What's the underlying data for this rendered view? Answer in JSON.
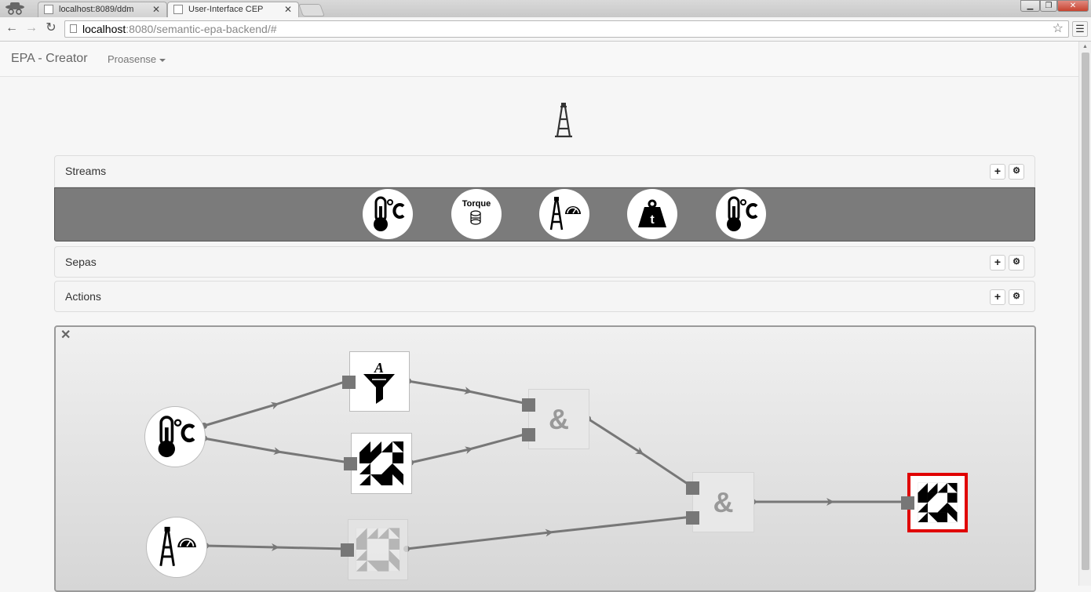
{
  "browser": {
    "tabs": [
      {
        "label": "localhost:8089/ddm",
        "active": false
      },
      {
        "label": "User-Interface CEP",
        "active": true
      }
    ],
    "url_host": "localhost",
    "url_rest": ":8080/semantic-epa-backend/#"
  },
  "navbar": {
    "brand": "EPA - Creator",
    "dropdown_label": "Proasense"
  },
  "panels": {
    "streams": {
      "title": "Streams"
    },
    "sepas": {
      "title": "Sepas"
    },
    "actions": {
      "title": "Actions"
    }
  },
  "stream_icons": [
    "thermometer-celsius",
    "torque",
    "oil-rig-gauge",
    "weight-t",
    "thermometer-celsius"
  ],
  "torque_label": "Torque",
  "pipeline_nodes": [
    "thermometer-celsius-stream",
    "oil-rig-gauge-stream",
    "filter-sepa",
    "pattern-sepa",
    "pattern-sepa-faded",
    "and-sepa",
    "and-sepa",
    "pattern-action-selected"
  ],
  "and_symbol": "&",
  "icons": {
    "close": "close-icon",
    "add": "plus-icon",
    "settings": "gear-icon"
  },
  "colors": {
    "stream_bar": "#7b7b7b",
    "selected_border": "#e00000",
    "connector": "#777777"
  }
}
